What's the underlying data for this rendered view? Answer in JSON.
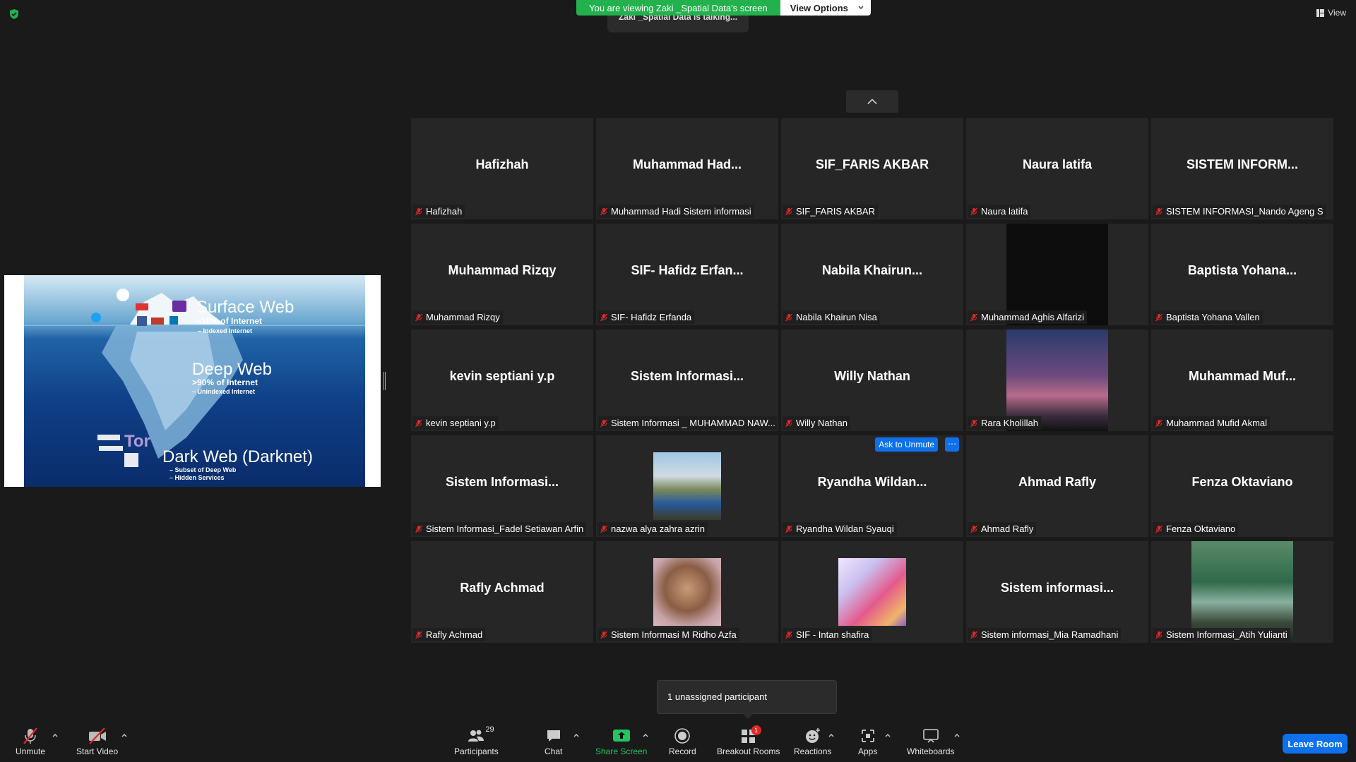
{
  "banner": {
    "viewing_text": "You are viewing Zaki _Spatial Data's screen",
    "view_options_label": "View Options",
    "talking_text": "Zaki _Spatial Data is talking..."
  },
  "top_right": {
    "view_label": "View"
  },
  "shared_slide": {
    "surface_title": "Surface Web",
    "surface_pct": "<10% of Internet",
    "surface_sub": "– Indexed Internet",
    "deep_title": "Deep Web",
    "deep_pct": ">90% of Internet",
    "deep_sub": "– Unindexed Internet",
    "dark_title": "Dark Web (Darknet)",
    "dark_sub1": "– Subset of Deep Web",
    "dark_sub2": "– Hidden Services",
    "tor_logo": "Tor"
  },
  "participants": [
    {
      "display": "Hafizhah",
      "label": "Hafizhah"
    },
    {
      "display": "Muhammad  Had...",
      "label": "Muhammad Hadi Sistem informasi"
    },
    {
      "display": "SIF_FARIS AKBAR",
      "label": "SIF_FARIS AKBAR"
    },
    {
      "display": "Naura latifa",
      "label": "Naura latifa"
    },
    {
      "display": "SISTEM  INFORM...",
      "label": "SISTEM INFORMASI_Nando Ageng S"
    },
    {
      "display": "Muhammad Rizqy",
      "label": "Muhammad Rizqy"
    },
    {
      "display": "SIF- Hafidz  Erfan...",
      "label": "SIF- Hafidz Erfanda"
    },
    {
      "display": "Nabila  Khairun...",
      "label": "Nabila Khairun Nisa"
    },
    {
      "display": "",
      "label": "Muhammad Aghis Alfarizi",
      "video": "dark"
    },
    {
      "display": "Baptista  Yohana...",
      "label": "Baptista Yohana Vallen"
    },
    {
      "display": "kevin septiani y.p",
      "label": "kevin septiani y.p"
    },
    {
      "display": "Sistem  Informasi...",
      "label": "Sistem Informasi _ MUHAMMAD NAW..."
    },
    {
      "display": "Willy Nathan",
      "label": "Willy Nathan"
    },
    {
      "display": "",
      "label": "Rara Kholillah",
      "video": "sunset"
    },
    {
      "display": "Muhammad  Muf...",
      "label": "Muhammad Mufid Akmal"
    },
    {
      "display": "Sistem  Informasi...",
      "label": "Sistem Informasi_Fadel Setiawan Arfin"
    },
    {
      "display": "",
      "label": "nazwa alya zahra azrin",
      "video": "car"
    },
    {
      "display": "Ryandha  Wildan...",
      "label": "Ryandha Wildan Syauqi",
      "ask_unmute": "Ask to Unmute"
    },
    {
      "display": "Ahmad Rafly",
      "label": "Ahmad Rafly"
    },
    {
      "display": "Fenza Oktaviano",
      "label": "Fenza Oktaviano"
    },
    {
      "display": "Rafly Achmad",
      "label": "Rafly Achmad"
    },
    {
      "display": "",
      "label": "Sistem Informasi M Ridho Azfa",
      "video": "portrait"
    },
    {
      "display": "",
      "label": "SIF - Intan shafira",
      "video": "anime"
    },
    {
      "display": "Sistem  informasi...",
      "label": "Sistem informasi_Mia Ramadhani"
    },
    {
      "display": "",
      "label": "Sistem Informasi_Atih Yulianti",
      "video": "outdoor"
    }
  ],
  "unassigned_text": "1 unassigned participant",
  "toolbar": {
    "unmute": "Unmute",
    "start_video": "Start Video",
    "participants": "Participants",
    "participants_count": "29",
    "chat": "Chat",
    "share_screen": "Share Screen",
    "record": "Record",
    "breakout_rooms": "Breakout Rooms",
    "breakout_badge": "1",
    "reactions": "Reactions",
    "apps": "Apps",
    "whiteboards": "Whiteboards",
    "leave_room": "Leave Room"
  },
  "colors": {
    "banner_green": "#22b14c",
    "accent_blue": "#0e71eb",
    "muted_red": "#e02828",
    "tile_bg": "#262626"
  }
}
